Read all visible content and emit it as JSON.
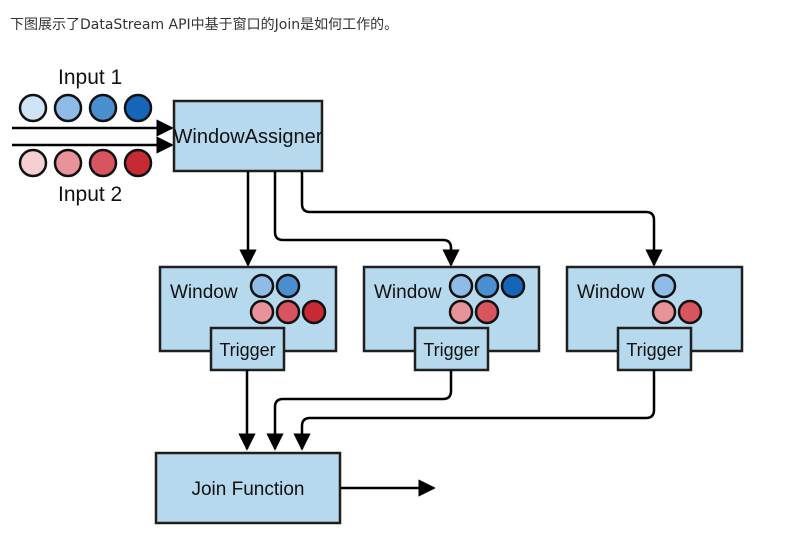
{
  "caption": "下图展示了DataStream API中基于窗口的Join是如何工作的。",
  "diagram": {
    "input1_label": "Input 1",
    "input2_label": "Input 2",
    "assigner_label": "WindowAssigner",
    "window_label": "Window",
    "trigger_label": "Trigger",
    "join_label": "Join Function"
  },
  "colors": {
    "box_fill": "#b7d9ee",
    "box_stroke": "#1f1f1f",
    "blue": [
      "#cfe4f5",
      "#8ebce6",
      "#4a90d0",
      "#1565b8"
    ],
    "red": [
      "#f6cfd2",
      "#e8939a",
      "#d85560",
      "#c62b35"
    ]
  }
}
